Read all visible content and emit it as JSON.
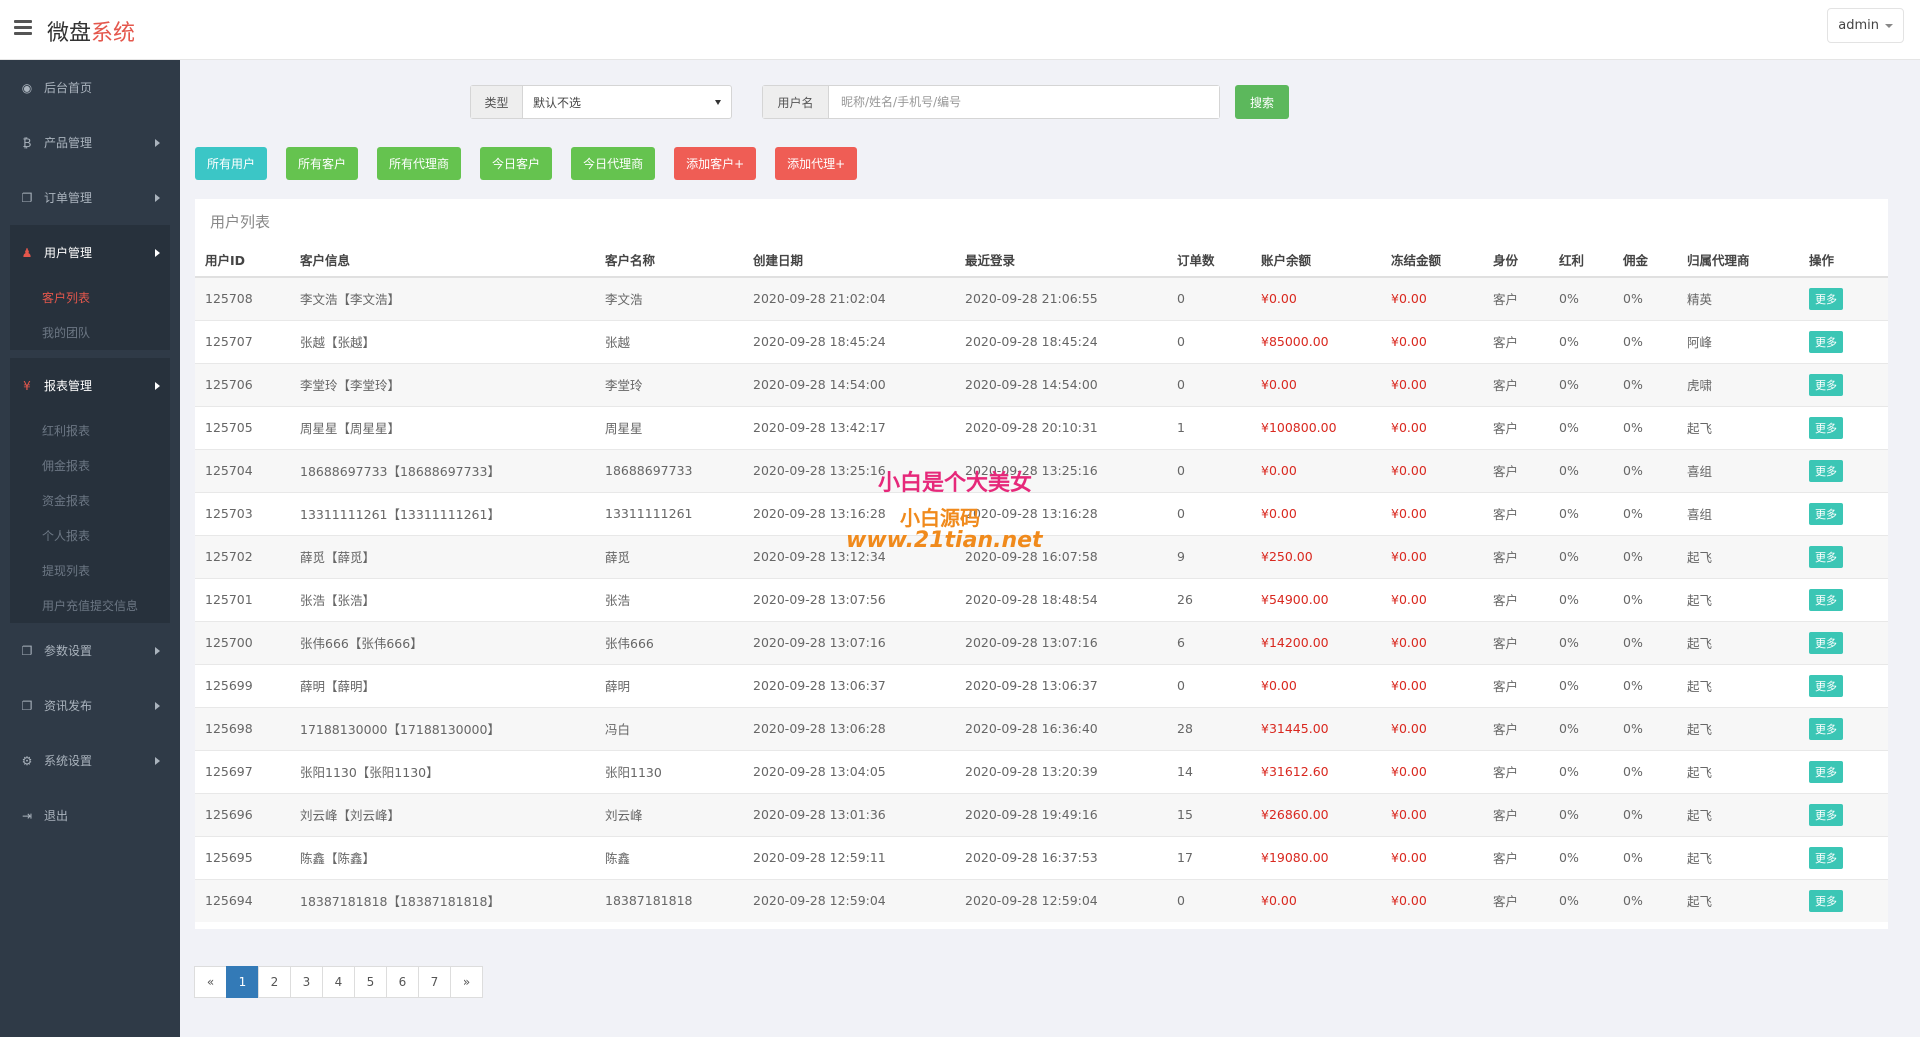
{
  "header": {
    "logo_main": "微盘",
    "logo_accent": "系统",
    "user": "admin"
  },
  "sidebar": {
    "items_top": [
      {
        "label": "后台首页",
        "icon": "dashboard-icon",
        "glyph": "◉",
        "arrow": false
      },
      {
        "label": "产品管理",
        "icon": "bitcoin-icon",
        "glyph": "₿",
        "arrow": true
      },
      {
        "label": "订单管理",
        "icon": "copy-icon",
        "glyph": "❐",
        "arrow": true
      }
    ],
    "user_group": {
      "label": "用户管理",
      "icon": "user-icon",
      "glyph": "♟",
      "subs": [
        "客户列表",
        "我的团队"
      ]
    },
    "report_group": {
      "label": "报表管理",
      "icon": "yen-icon",
      "glyph": "¥",
      "subs": [
        "红利报表",
        "佣金报表",
        "资金报表",
        "个人报表",
        "提现列表",
        "用户充值提交信息"
      ]
    },
    "items_bottom": [
      {
        "label": "参数设置",
        "icon": "copy-icon",
        "glyph": "❐",
        "arrow": true
      },
      {
        "label": "资讯发布",
        "icon": "copy-icon",
        "glyph": "❐",
        "arrow": true
      },
      {
        "label": "系统设置",
        "icon": "gears-icon",
        "glyph": "⚙",
        "arrow": true
      },
      {
        "label": "退出",
        "icon": "sign-out-icon",
        "glyph": "⇥",
        "arrow": false
      }
    ]
  },
  "search": {
    "type_label": "类型",
    "type_value": "默认不选",
    "user_label": "用户名",
    "user_placeholder": "昵称/姓名/手机号/编号",
    "button": "搜索"
  },
  "actions": [
    {
      "label": "所有用户",
      "style": "teal"
    },
    {
      "label": "所有客户",
      "style": "green"
    },
    {
      "label": "所有代理商",
      "style": "green"
    },
    {
      "label": "今日客户",
      "style": "green"
    },
    {
      "label": "今日代理商",
      "style": "green"
    },
    {
      "label": "添加客户+",
      "style": "red"
    },
    {
      "label": "添加代理+",
      "style": "red"
    }
  ],
  "table": {
    "title": "用户列表",
    "columns": [
      "用户ID",
      "客户信息",
      "客户名称",
      "创建日期",
      "最近登录",
      "订单数",
      "账户余额",
      "冻结金额",
      "身份",
      "红利",
      "佣金",
      "归属代理商",
      "操作"
    ],
    "rows": [
      [
        "125708",
        "李文浩【李文浩】",
        "李文浩",
        "2020-09-28 21:02:04",
        "2020-09-28 21:06:55",
        "0",
        "¥0.00",
        "¥0.00",
        "客户",
        "0%",
        "0%",
        "精英",
        "更多"
      ],
      [
        "125707",
        "张越【张越】",
        "张越",
        "2020-09-28 18:45:24",
        "2020-09-28 18:45:24",
        "0",
        "¥85000.00",
        "¥0.00",
        "客户",
        "0%",
        "0%",
        "阿峰",
        "更多"
      ],
      [
        "125706",
        "李堂玲【李堂玲】",
        "李堂玲",
        "2020-09-28 14:54:00",
        "2020-09-28 14:54:00",
        "0",
        "¥0.00",
        "¥0.00",
        "客户",
        "0%",
        "0%",
        "虎啸",
        "更多"
      ],
      [
        "125705",
        "周星星【周星星】",
        "周星星",
        "2020-09-28 13:42:17",
        "2020-09-28 20:10:31",
        "1",
        "¥100800.00",
        "¥0.00",
        "客户",
        "0%",
        "0%",
        "起飞",
        "更多"
      ],
      [
        "125704",
        "18688697733【18688697733】",
        "18688697733",
        "2020-09-28 13:25:16",
        "2020-09-28 13:25:16",
        "0",
        "¥0.00",
        "¥0.00",
        "客户",
        "0%",
        "0%",
        "喜组",
        "更多"
      ],
      [
        "125703",
        "13311111261【13311111261】",
        "13311111261",
        "2020-09-28 13:16:28",
        "2020-09-28 13:16:28",
        "0",
        "¥0.00",
        "¥0.00",
        "客户",
        "0%",
        "0%",
        "喜组",
        "更多"
      ],
      [
        "125702",
        "薛觅【薛觅】",
        "薛觅",
        "2020-09-28 13:12:34",
        "2020-09-28 16:07:58",
        "9",
        "¥250.00",
        "¥0.00",
        "客户",
        "0%",
        "0%",
        "起飞",
        "更多"
      ],
      [
        "125701",
        "张浩【张浩】",
        "张浩",
        "2020-09-28 13:07:56",
        "2020-09-28 18:48:54",
        "26",
        "¥54900.00",
        "¥0.00",
        "客户",
        "0%",
        "0%",
        "起飞",
        "更多"
      ],
      [
        "125700",
        "张伟666【张伟666】",
        "张伟666",
        "2020-09-28 13:07:16",
        "2020-09-28 13:07:16",
        "6",
        "¥14200.00",
        "¥0.00",
        "客户",
        "0%",
        "0%",
        "起飞",
        "更多"
      ],
      [
        "125699",
        "薛明【薛明】",
        "薛明",
        "2020-09-28 13:06:37",
        "2020-09-28 13:06:37",
        "0",
        "¥0.00",
        "¥0.00",
        "客户",
        "0%",
        "0%",
        "起飞",
        "更多"
      ],
      [
        "125698",
        "17188130000【17188130000】",
        "冯白",
        "2020-09-28 13:06:28",
        "2020-09-28 16:36:40",
        "28",
        "¥31445.00",
        "¥0.00",
        "客户",
        "0%",
        "0%",
        "起飞",
        "更多"
      ],
      [
        "125697",
        "张阳1130【张阳1130】",
        "张阳1130",
        "2020-09-28 13:04:05",
        "2020-09-28 13:20:39",
        "14",
        "¥31612.60",
        "¥0.00",
        "客户",
        "0%",
        "0%",
        "起飞",
        "更多"
      ],
      [
        "125696",
        "刘云峰【刘云峰】",
        "刘云峰",
        "2020-09-28 13:01:36",
        "2020-09-28 19:49:16",
        "15",
        "¥26860.00",
        "¥0.00",
        "客户",
        "0%",
        "0%",
        "起飞",
        "更多"
      ],
      [
        "125695",
        "陈鑫【陈鑫】",
        "陈鑫",
        "2020-09-28 12:59:11",
        "2020-09-28 16:37:53",
        "17",
        "¥19080.00",
        "¥0.00",
        "客户",
        "0%",
        "0%",
        "起飞",
        "更多"
      ],
      [
        "125694",
        "18387181818【18387181818】",
        "18387181818",
        "2020-09-28 12:59:04",
        "2020-09-28 12:59:04",
        "0",
        "¥0.00",
        "¥0.00",
        "客户",
        "0%",
        "0%",
        "起飞",
        "更多"
      ]
    ]
  },
  "pagination": {
    "prev": "«",
    "pages": [
      "1",
      "2",
      "3",
      "4",
      "5",
      "6",
      "7"
    ],
    "next": "»",
    "active": "1"
  },
  "watermark": {
    "line1": "小白是个大美女",
    "line2": "小白源码",
    "line3": "www.21tian.net"
  }
}
